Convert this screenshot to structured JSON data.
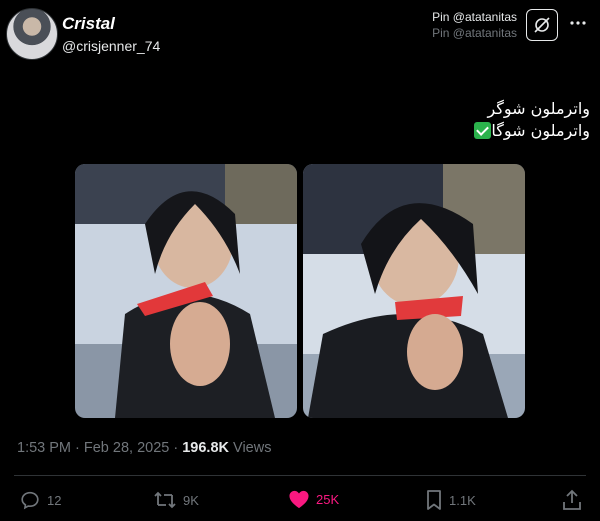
{
  "author": {
    "display_name": "Cristal",
    "handle": "@crisjenner_74"
  },
  "pin": {
    "line1": "Pin @atatanitas",
    "line2": "Pin @atatanitas"
  },
  "tweet": {
    "line1": "واترملون شوگر",
    "line2": "واترملون شوگا"
  },
  "meta": {
    "time_date": "1:53 PM · Feb 28, 2025 · ",
    "views_count": "196.8K",
    "views_label": " Views"
  },
  "actions": {
    "replies": "12",
    "retweets": "9K",
    "likes": "25K",
    "bookmarks": "1.1K"
  },
  "colors": {
    "like": "#f91880",
    "muted": "#71767b"
  }
}
